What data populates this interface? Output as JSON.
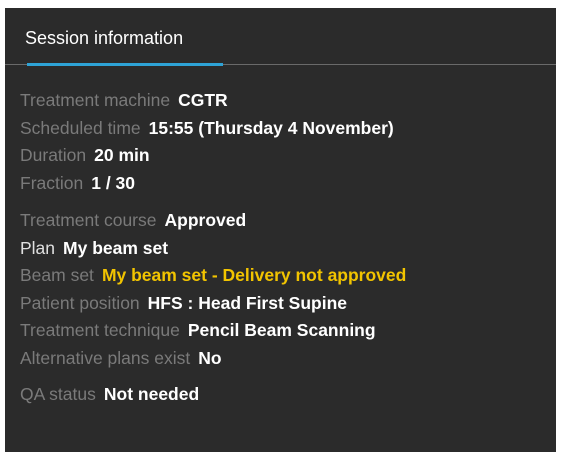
{
  "tab": {
    "label": "Session information"
  },
  "colors": {
    "accent": "#2ea3d6",
    "warning": "#f2c400",
    "panel_bg": "#2b2b2b"
  },
  "session": {
    "treatment_machine": {
      "label": "Treatment machine",
      "value": "CGTR"
    },
    "scheduled_time": {
      "label": "Scheduled time",
      "value": "15:55 (Thursday 4 November)"
    },
    "duration": {
      "label": "Duration",
      "value": "20 min"
    },
    "fraction": {
      "label": "Fraction",
      "value": "1 / 30"
    }
  },
  "course": {
    "treatment_course": {
      "label": "Treatment course",
      "value": "Approved"
    },
    "plan": {
      "label": "Plan",
      "value": "My beam set"
    },
    "beam_set": {
      "label": "Beam set",
      "value": "My beam set - Delivery not approved"
    },
    "patient_position": {
      "label": "Patient position",
      "value": "HFS : Head First Supine"
    },
    "treatment_technique": {
      "label": "Treatment technique",
      "value": "Pencil Beam Scanning"
    },
    "alternative_plans": {
      "label": "Alternative plans exist",
      "value": "No"
    }
  },
  "qa": {
    "qa_status": {
      "label": "QA status",
      "value": "Not needed"
    }
  }
}
